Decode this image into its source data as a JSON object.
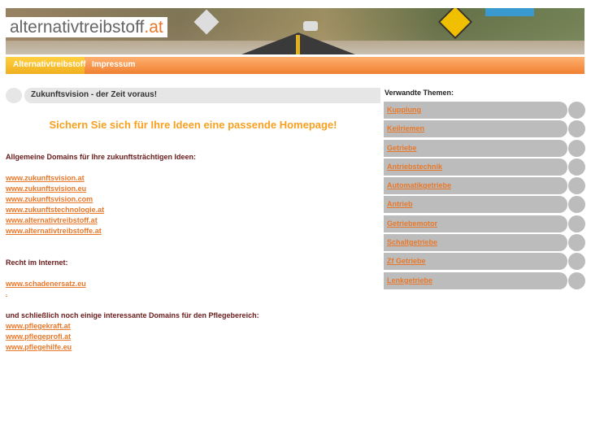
{
  "header": {
    "logo_name": "alternativtreibstoff",
    "logo_tld": ".at"
  },
  "nav": [
    {
      "label": "Alternativtreibstoff"
    },
    {
      "label": "Impressum"
    }
  ],
  "main": {
    "title": "Zukunftsvision - der Zeit voraus!",
    "slogan": "Sichern Sie sich für Ihre Ideen eine passende Homepage!",
    "section1_heading": "Allgemeine Domains für Ihre zukunftsträchtigen Ideen:",
    "section1_links": [
      "www.zukunftsvision.at",
      "www.zukunftsvision.eu",
      "www.zukunftsvision.com",
      "www.zukunftstechnologie.at",
      "www.alternativtreibstoff.at",
      "www.alternativtreibstoffe.at"
    ],
    "section2_heading": "Recht im Internet:",
    "section2_links": [
      "www.schadenersatz.eu",
      "."
    ],
    "section3_heading": "und schließlich  noch einige interessante Domains für den Pflegebereich:",
    "section3_links": [
      "www.pflegekraft.at",
      "www.pflegeprofi.at",
      "www.pflegehilfe.eu"
    ]
  },
  "sidebar": {
    "title": "Verwandte Themen:",
    "items": [
      "Kupplung",
      "Keilriemen",
      "Getriebe",
      "Antriebstechnik",
      "Automatikgetriebe",
      "Antrieb",
      "Getriebemotor",
      "Schaltgetriebe",
      "Zf Getriebe",
      "Lenkgetriebe"
    ]
  },
  "colors": {
    "accent": "#e8782a",
    "nav": "#f08030",
    "nav_active": "#f0b020",
    "slogan": "#f8a020",
    "heading": "#6a1a1a"
  }
}
